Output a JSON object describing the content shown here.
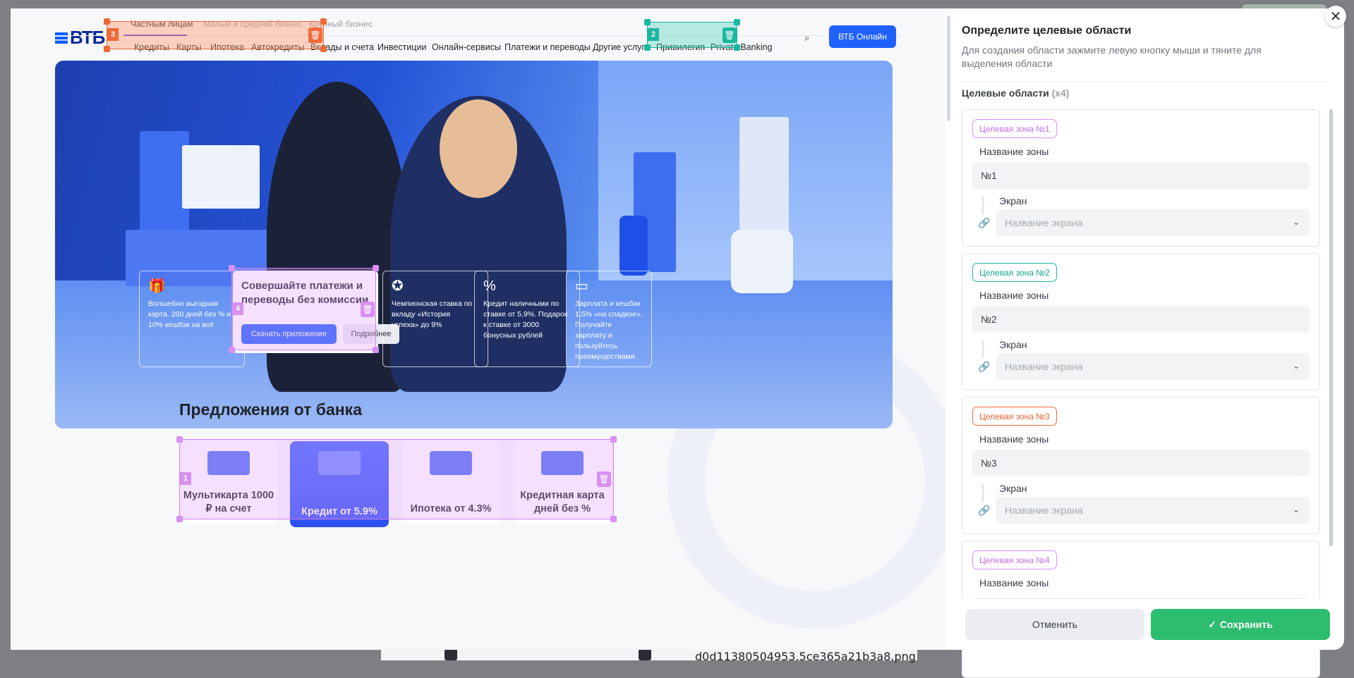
{
  "background": {
    "filename": "d0d11380504953.5ce365a21b3a8.png"
  },
  "site": {
    "logo": "ВТБ",
    "segments": [
      "Частным лицам",
      "Малый и средний бизнес",
      "Крупный бизнес"
    ],
    "nav": [
      "Кредиты",
      "Карты",
      "Ипотека",
      "Автокредиты",
      "Вклады и счета",
      "Инвестиции",
      "Онлайн-сервисы",
      "Платежи и переводы",
      "Другие услуги",
      "Привилегия",
      "Private Banking"
    ],
    "online_button": "ВТБ Онлайн",
    "hero_cards": [
      "Волшебно выгодная карта. 200 дней без % и 10% кешбэк на всё",
      "Чемпионская ставка по вкладу «История успеха» до 9%",
      "Кредит наличными по ставке от 5.9%. Подарок к ставке от 3000 бонусных рублей",
      "Зарплата и кешбэк 1,5% «на сладкое». Получайте зарплату и пользуйтесь преимуществами"
    ],
    "hero_main": {
      "title": "Совершайте платежи и переводы без комиссии",
      "primary": "Скачать приложение",
      "secondary": "Подробнее"
    },
    "section_title": "Предложения от банка",
    "offers": [
      "Мультикарта 1000 ₽ на счет",
      "Кредит от 5.9%",
      "Ипотека от 4.3%",
      "Кредитная карта дней без %"
    ]
  },
  "zones_overlay": [
    {
      "num": "1",
      "color": "#d890f2"
    },
    {
      "num": "2",
      "color": "#1bb7a0"
    },
    {
      "num": "3",
      "color": "#f06a3a"
    },
    {
      "num": "4",
      "color": "#d890f2"
    }
  ],
  "panel": {
    "title": "Определите целевые области",
    "subtitle": "Для создания области зажмите левую кнопку мыши и тяните для выделения области",
    "count_label": "Целевые области",
    "count_value": "(x4)",
    "zones": [
      {
        "tag": "Целевая зона №1",
        "tag_color": "#c86bea",
        "name_label": "Название зоны",
        "name_value": "№1",
        "screen_label": "Экран",
        "screen_placeholder": "Название экрана"
      },
      {
        "tag": "Целевая зона №2",
        "tag_color": "#17a68f",
        "name_label": "Название зоны",
        "name_value": "№2",
        "screen_label": "Экран",
        "screen_placeholder": "Название экрана"
      },
      {
        "tag": "Целевая зона №3",
        "tag_color": "#e8622f",
        "name_label": "Название зоны",
        "name_value": "№3",
        "screen_label": "Экран",
        "screen_placeholder": "Название экрана"
      },
      {
        "tag": "Целевая зона №4",
        "tag_color": "#c86bea",
        "name_label": "Название зоны",
        "name_value": "",
        "screen_label": "",
        "screen_placeholder": ""
      }
    ],
    "cancel": "Отменить",
    "save": "Сохранить"
  }
}
